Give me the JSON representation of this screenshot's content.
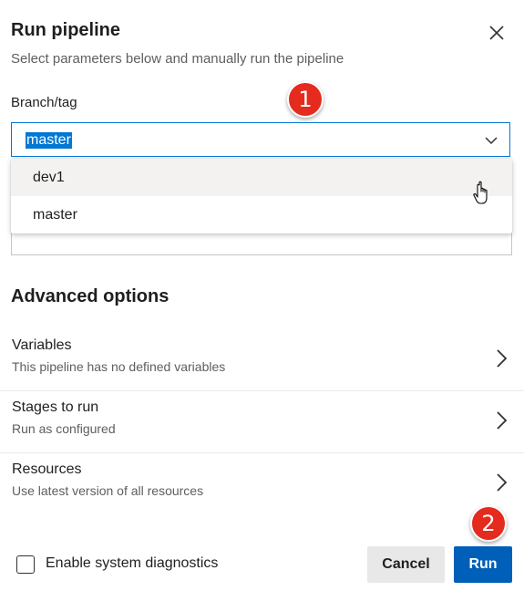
{
  "dialog": {
    "title": "Run pipeline",
    "subtitle": "Select parameters below and manually run the pipeline"
  },
  "branch": {
    "label": "Branch/tag",
    "value": "master",
    "options": [
      "dev1",
      "master"
    ],
    "hovered_option": "dev1"
  },
  "annotations": {
    "badge_1": "1",
    "badge_2": "2",
    "badge_color": "#e52a1e"
  },
  "advanced": {
    "title": "Advanced options",
    "items": [
      {
        "title": "Variables",
        "description": "This pipeline has no defined variables"
      },
      {
        "title": "Stages to run",
        "description": "Run as configured"
      },
      {
        "title": "Resources",
        "description": "Use latest version of all resources"
      }
    ]
  },
  "footer": {
    "diagnostics_label": "Enable system diagnostics",
    "diagnostics_checked": false,
    "cancel_label": "Cancel",
    "run_label": "Run"
  },
  "colors": {
    "accent": "#0078d4",
    "primary_button": "#005fb8",
    "secondary_button": "#e8e8e8"
  },
  "icons": {
    "close": "close-icon",
    "dropdown": "chevron-down-icon",
    "option_arrow": "chevron-right-icon",
    "pointer": "hand-cursor-icon"
  }
}
